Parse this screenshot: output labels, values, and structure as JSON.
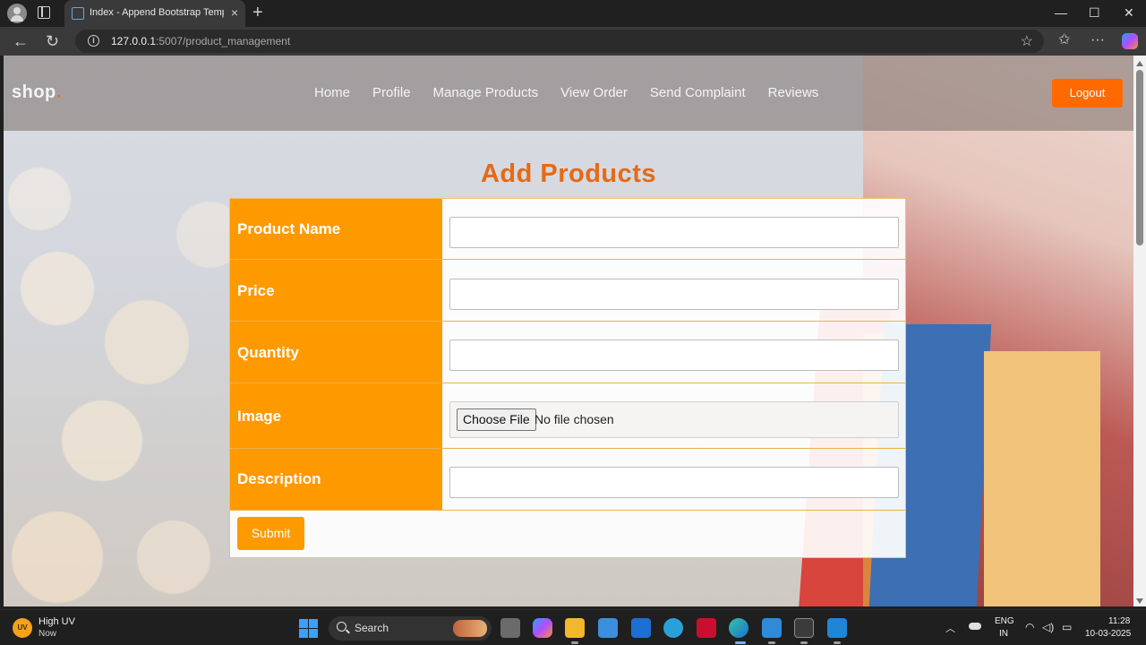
{
  "browser": {
    "tab_title": "Index - Append Bootstrap Template",
    "tab_close": "×",
    "new_tab": "+",
    "url_host": "127.0.0.1",
    "url_path": ":5007/product_management",
    "back": "←",
    "reload": "↻",
    "favorites_star": "☆",
    "window_minimize": "—",
    "window_maximize": "☐",
    "window_close": "✕",
    "favorites_icon": "✩",
    "more_icon": "···"
  },
  "site": {
    "logo": "shop",
    "logo_dot": ".",
    "nav": [
      "Home",
      "Profile",
      "Manage Products",
      "View Order",
      "Send Complaint",
      "Reviews"
    ],
    "logout": "Logout",
    "accent": "#ff6a00"
  },
  "form": {
    "title": "Add Products",
    "fields": [
      {
        "label": "Product Name",
        "value": ""
      },
      {
        "label": "Price",
        "value": ""
      },
      {
        "label": "Quantity",
        "value": ""
      },
      {
        "label": "Image",
        "file_button": "Choose File",
        "file_status": "No file chosen"
      },
      {
        "label": "Description",
        "value": ""
      }
    ],
    "submit": "Submit",
    "label_color": "#ff9900",
    "title_color": "#e56a17"
  },
  "taskbar": {
    "weather_badge": "UV",
    "weather_title": "High UV",
    "weather_sub": "Now",
    "search_label": "Search",
    "lang_line1": "ENG",
    "lang_line2": "IN",
    "time": "11:28",
    "date": "10-03-2025",
    "tray_caret": "︿",
    "wifi_icon": "wifi-icon",
    "volume_icon": "volume-icon",
    "battery_icon": "battery-icon"
  }
}
